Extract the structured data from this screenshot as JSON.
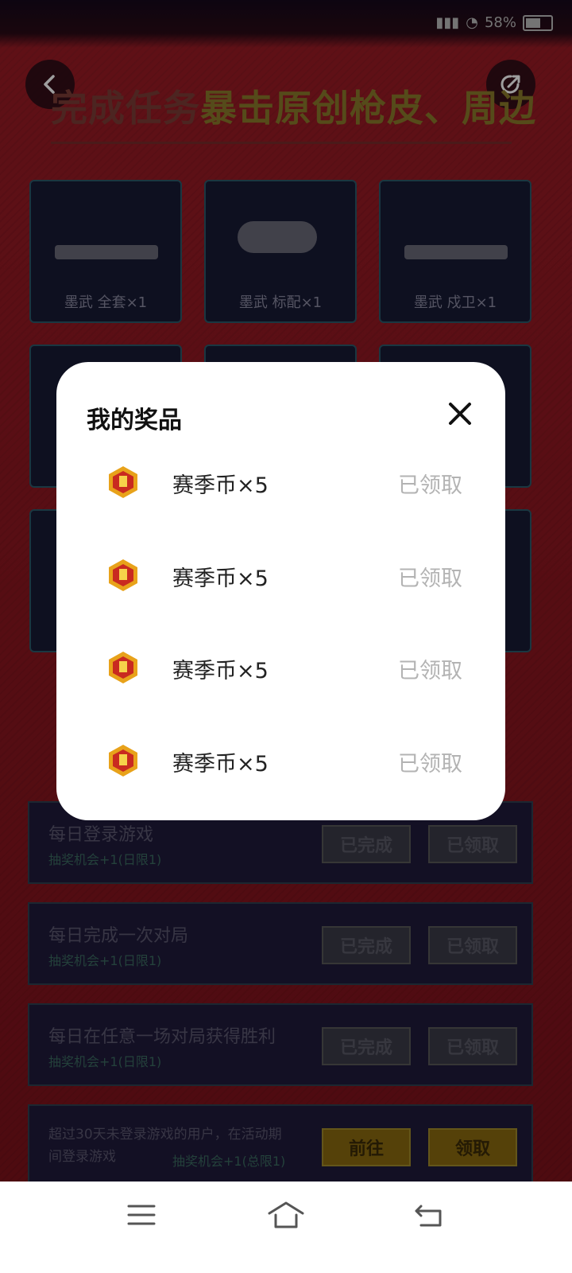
{
  "status_bar": {
    "battery_text": "58%"
  },
  "page": {
    "headline_part1": "完成任务",
    "headline_part2": "暴击原创枪皮、周边",
    "prizes": [
      {
        "label": "墨武 全套×1"
      },
      {
        "label": "墨武 标配×1"
      },
      {
        "label": "墨武 戍卫×1"
      }
    ],
    "tasks": [
      {
        "title": "每日登录游戏",
        "sub": "抽奖机会+1(日限1)",
        "btn1": "已完成",
        "btn2": "已领取"
      },
      {
        "title": "每日完成一次对局",
        "sub": "抽奖机会+1(日限1)",
        "btn1": "已完成",
        "btn2": "已领取"
      },
      {
        "title": "每日在任意一场对局获得胜利",
        "sub": "抽奖机会+1(日限1)",
        "btn1": "已完成",
        "btn2": "已领取"
      },
      {
        "title": "超过30天未登录游戏的用户，在活动期间登录游戏",
        "sub": "抽奖机会+1(总限1)",
        "btn1": "前往",
        "btn2": "领取"
      }
    ]
  },
  "modal": {
    "title": "我的奖品",
    "items": [
      {
        "name": "赛季币×5",
        "status": "已领取"
      },
      {
        "name": "赛季币×5",
        "status": "已领取"
      },
      {
        "name": "赛季币×5",
        "status": "已领取"
      },
      {
        "name": "赛季币×5",
        "status": "已领取"
      }
    ]
  }
}
